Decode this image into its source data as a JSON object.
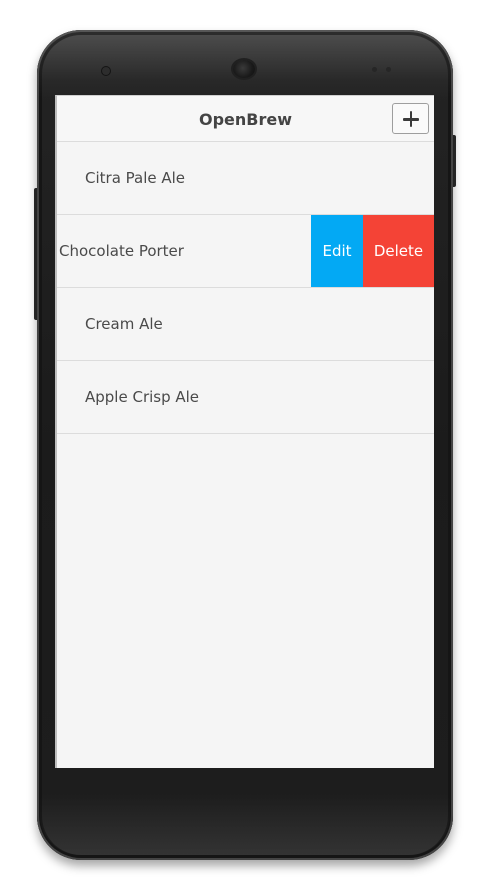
{
  "app": {
    "title": "OpenBrew",
    "add_icon": "plus-icon"
  },
  "beers": [
    {
      "name": "Citra Pale Ale"
    },
    {
      "name": "Chocolate Porter",
      "swiped": true,
      "actions": {
        "edit": "Edit",
        "delete": "Delete"
      }
    },
    {
      "name": "Cream Ale"
    },
    {
      "name": "Apple Crisp Ale"
    }
  ],
  "colors": {
    "edit": "#03a9f4",
    "delete": "#f44336",
    "background": "#f5f5f5"
  }
}
